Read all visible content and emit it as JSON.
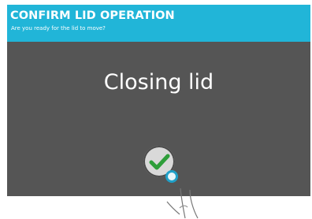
{
  "header": {
    "title": "CONFIRM LID OPERATION",
    "subtitle": "Are you ready for the lid to move?"
  },
  "main": {
    "status": "Closing lid"
  },
  "colors": {
    "header_bg": "#21b5d8",
    "screen_bg": "#555555",
    "check": "#2e9e3a",
    "touch_ring": "#1fa0c8"
  },
  "icons": {
    "confirm": "checkmark-icon",
    "touch": "touch-point-icon",
    "hand": "hand-pointer-icon"
  }
}
